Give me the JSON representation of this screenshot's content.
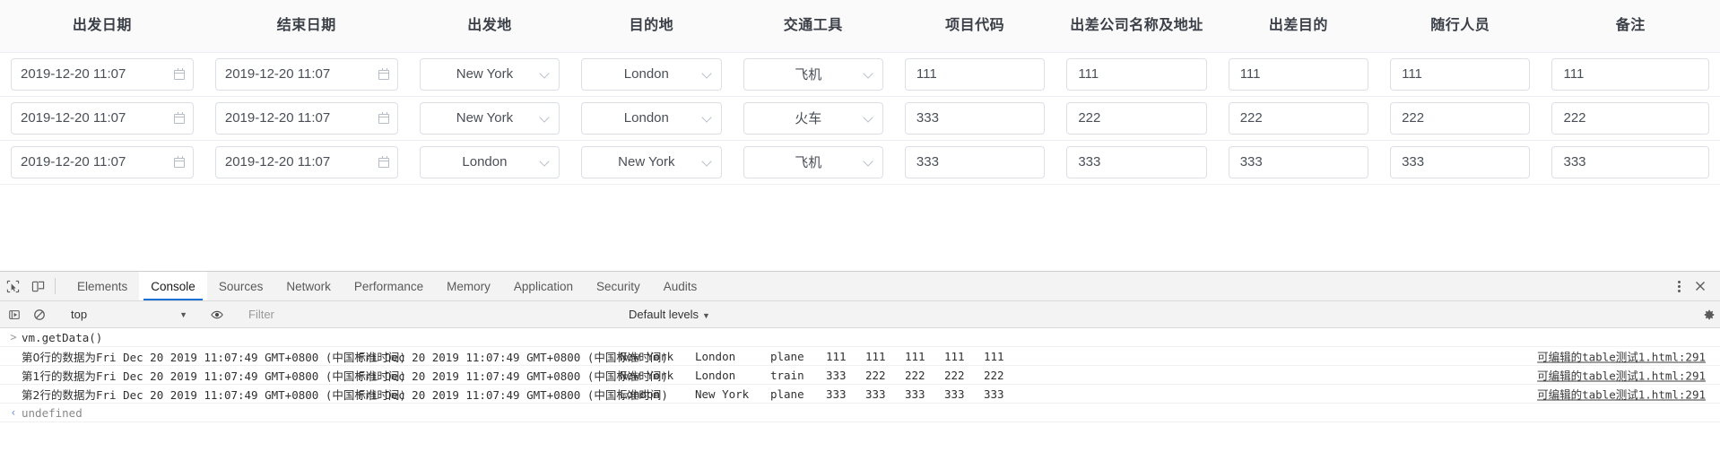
{
  "table": {
    "columns": [
      {
        "key": "depart_date",
        "label": "出发日期"
      },
      {
        "key": "end_date",
        "label": "结束日期"
      },
      {
        "key": "origin",
        "label": "出发地"
      },
      {
        "key": "destination",
        "label": "目的地"
      },
      {
        "key": "transport",
        "label": "交通工具"
      },
      {
        "key": "project_code",
        "label": "项目代码"
      },
      {
        "key": "company",
        "label": "出差公司名称及地址"
      },
      {
        "key": "purpose",
        "label": "出差目的"
      },
      {
        "key": "companions",
        "label": "随行人员"
      },
      {
        "key": "remark",
        "label": "备注"
      }
    ],
    "rows": [
      {
        "depart_date": "2019-12-20 11:07",
        "end_date": "2019-12-20 11:07",
        "origin": "New York",
        "destination": "London",
        "transport": "飞机",
        "project_code": "111",
        "company": "111",
        "purpose": "111",
        "companions": "111",
        "remark": "111"
      },
      {
        "depart_date": "2019-12-20 11:07",
        "end_date": "2019-12-20 11:07",
        "origin": "New York",
        "destination": "London",
        "transport": "火车",
        "project_code": "333",
        "company": "222",
        "purpose": "222",
        "companions": "222",
        "remark": "222"
      },
      {
        "depart_date": "2019-12-20 11:07",
        "end_date": "2019-12-20 11:07",
        "origin": "London",
        "destination": "New York",
        "transport": "飞机",
        "project_code": "333",
        "company": "333",
        "purpose": "333",
        "companions": "333",
        "remark": "333"
      }
    ]
  },
  "devtools": {
    "tabs": [
      {
        "label": "Elements",
        "active": false
      },
      {
        "label": "Console",
        "active": true
      },
      {
        "label": "Sources",
        "active": false
      },
      {
        "label": "Network",
        "active": false
      },
      {
        "label": "Performance",
        "active": false
      },
      {
        "label": "Memory",
        "active": false
      },
      {
        "label": "Application",
        "active": false
      },
      {
        "label": "Security",
        "active": false
      },
      {
        "label": "Audits",
        "active": false
      }
    ],
    "icons": {
      "inspect": "inspect-element-icon",
      "device": "device-toolbar-icon",
      "execute": "execute-snippet-icon",
      "clear": "clear-console-icon",
      "eye": "live-expression-icon",
      "kebab": "more-options-icon",
      "close": "close-devtools-icon",
      "gear": "settings-icon"
    },
    "filterbar": {
      "context": "top",
      "filter_placeholder": "Filter",
      "levels": "Default levels",
      "caret": "▼"
    },
    "accent_color": "#1772d3"
  },
  "console": {
    "prompt_arrow": ">",
    "result_arrow": "‹",
    "input_command": "vm.getData()",
    "result_value": "undefined",
    "source_link": "可编辑的table测试1.html:291",
    "logs": [
      {
        "prefix": "第0行的数据为",
        "date1": "Fri Dec 20 2019 11:07:49 GMT+0800 (中国标准时间)",
        "date2": "Fri Dec 20 2019 11:07:49 GMT+0800 (中国标准时间)",
        "origin": "New York",
        "destination": "London",
        "transport": "plane",
        "v1": "111",
        "v2": "111",
        "v3": "111",
        "v4": "111",
        "v5": "111"
      },
      {
        "prefix": "第1行的数据为",
        "date1": "Fri Dec 20 2019 11:07:49 GMT+0800 (中国标准时间)",
        "date2": "Fri Dec 20 2019 11:07:49 GMT+0800 (中国标准时间)",
        "origin": "New York",
        "destination": "London",
        "transport": "train",
        "v1": "333",
        "v2": "222",
        "v3": "222",
        "v4": "222",
        "v5": "222"
      },
      {
        "prefix": "第2行的数据为",
        "date1": "Fri Dec 20 2019 11:07:49 GMT+0800 (中国标准时间)",
        "date2": "Fri Dec 20 2019 11:07:49 GMT+0800 (中国标准时间)",
        "origin": "London",
        "destination": "New York",
        "transport": "plane",
        "v1": "333",
        "v2": "333",
        "v3": "333",
        "v4": "333",
        "v5": "333"
      }
    ]
  }
}
